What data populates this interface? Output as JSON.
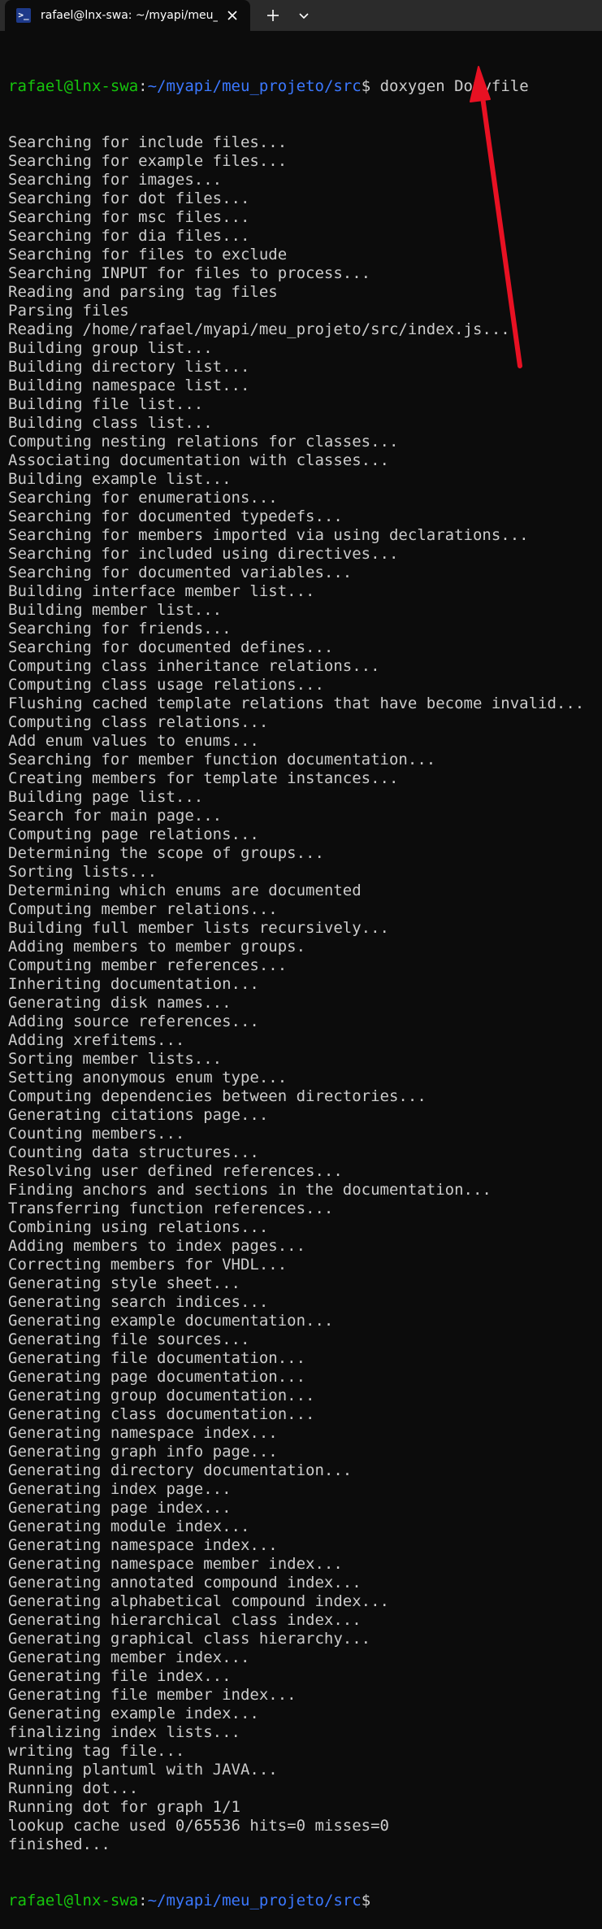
{
  "window": {
    "tab_title": "rafael@lnx-swa: ~/myapi/meu_projeto/src",
    "icons": {
      "tab": "terminal-icon",
      "close": "close-icon",
      "new_tab": "plus-icon",
      "dropdown": "chevron-down-icon"
    }
  },
  "terminal": {
    "prompt_user": "rafael@lnx-swa",
    "prompt_sep": ":",
    "prompt_path": "~/myapi/meu_projeto/src",
    "prompt_symbol": "$",
    "command": " doxygen Doxyfile",
    "output": [
      "Searching for include files...",
      "Searching for example files...",
      "Searching for images...",
      "Searching for dot files...",
      "Searching for msc files...",
      "Searching for dia files...",
      "Searching for files to exclude",
      "Searching INPUT for files to process...",
      "Reading and parsing tag files",
      "Parsing files",
      "Reading /home/rafael/myapi/meu_projeto/src/index.js...",
      "Building group list...",
      "Building directory list...",
      "Building namespace list...",
      "Building file list...",
      "Building class list...",
      "Computing nesting relations for classes...",
      "Associating documentation with classes...",
      "Building example list...",
      "Searching for enumerations...",
      "Searching for documented typedefs...",
      "Searching for members imported via using declarations...",
      "Searching for included using directives...",
      "Searching for documented variables...",
      "Building interface member list...",
      "Building member list...",
      "Searching for friends...",
      "Searching for documented defines...",
      "Computing class inheritance relations...",
      "Computing class usage relations...",
      "Flushing cached template relations that have become invalid...",
      "Computing class relations...",
      "Add enum values to enums...",
      "Searching for member function documentation...",
      "Creating members for template instances...",
      "Building page list...",
      "Search for main page...",
      "Computing page relations...",
      "Determining the scope of groups...",
      "Sorting lists...",
      "Determining which enums are documented",
      "Computing member relations...",
      "Building full member lists recursively...",
      "Adding members to member groups.",
      "Computing member references...",
      "Inheriting documentation...",
      "Generating disk names...",
      "Adding source references...",
      "Adding xrefitems...",
      "Sorting member lists...",
      "Setting anonymous enum type...",
      "Computing dependencies between directories...",
      "Generating citations page...",
      "Counting members...",
      "Counting data structures...",
      "Resolving user defined references...",
      "Finding anchors and sections in the documentation...",
      "Transferring function references...",
      "Combining using relations...",
      "Adding members to index pages...",
      "Correcting members for VHDL...",
      "Generating style sheet...",
      "Generating search indices...",
      "Generating example documentation...",
      "Generating file sources...",
      "Generating file documentation...",
      "Generating page documentation...",
      "Generating group documentation...",
      "Generating class documentation...",
      "Generating namespace index...",
      "Generating graph info page...",
      "Generating directory documentation...",
      "Generating index page...",
      "Generating page index...",
      "Generating module index...",
      "Generating namespace index...",
      "Generating namespace member index...",
      "Generating annotated compound index...",
      "Generating alphabetical compound index...",
      "Generating hierarchical class index...",
      "Generating graphical class hierarchy...",
      "Generating member index...",
      "Generating file index...",
      "Generating file member index...",
      "Generating example index...",
      "finalizing index lists...",
      "writing tag file...",
      "Running plantuml with JAVA...",
      "Running dot...",
      "Running dot for graph 1/1",
      "lookup cache used 0/65536 hits=0 misses=0",
      "finished..."
    ]
  },
  "colors": {
    "background": "#0c0c0c",
    "tabbar": "#2b2b2b",
    "text": "#cccccc",
    "prompt_user": "#16c60c",
    "prompt_path": "#3b78ff",
    "annotation_arrow": "#e81123"
  }
}
